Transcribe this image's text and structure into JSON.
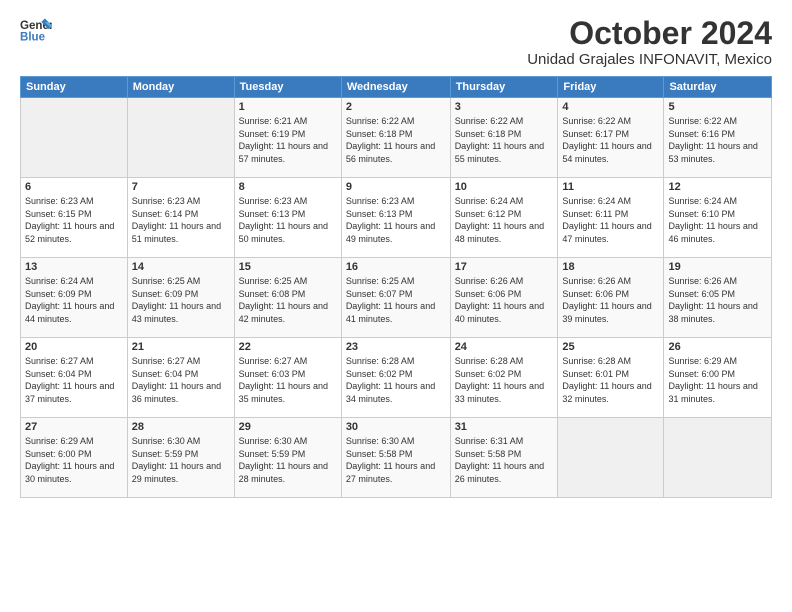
{
  "header": {
    "logo_general": "General",
    "logo_blue": "Blue",
    "title": "October 2024",
    "subtitle": "Unidad Grajales INFONAVIT, Mexico"
  },
  "weekdays": [
    "Sunday",
    "Monday",
    "Tuesday",
    "Wednesday",
    "Thursday",
    "Friday",
    "Saturday"
  ],
  "weeks": [
    [
      {
        "day": "",
        "info": ""
      },
      {
        "day": "",
        "info": ""
      },
      {
        "day": "1",
        "info": "Sunrise: 6:21 AM\nSunset: 6:19 PM\nDaylight: 11 hours and 57 minutes."
      },
      {
        "day": "2",
        "info": "Sunrise: 6:22 AM\nSunset: 6:18 PM\nDaylight: 11 hours and 56 minutes."
      },
      {
        "day": "3",
        "info": "Sunrise: 6:22 AM\nSunset: 6:18 PM\nDaylight: 11 hours and 55 minutes."
      },
      {
        "day": "4",
        "info": "Sunrise: 6:22 AM\nSunset: 6:17 PM\nDaylight: 11 hours and 54 minutes."
      },
      {
        "day": "5",
        "info": "Sunrise: 6:22 AM\nSunset: 6:16 PM\nDaylight: 11 hours and 53 minutes."
      }
    ],
    [
      {
        "day": "6",
        "info": "Sunrise: 6:23 AM\nSunset: 6:15 PM\nDaylight: 11 hours and 52 minutes."
      },
      {
        "day": "7",
        "info": "Sunrise: 6:23 AM\nSunset: 6:14 PM\nDaylight: 11 hours and 51 minutes."
      },
      {
        "day": "8",
        "info": "Sunrise: 6:23 AM\nSunset: 6:13 PM\nDaylight: 11 hours and 50 minutes."
      },
      {
        "day": "9",
        "info": "Sunrise: 6:23 AM\nSunset: 6:13 PM\nDaylight: 11 hours and 49 minutes."
      },
      {
        "day": "10",
        "info": "Sunrise: 6:24 AM\nSunset: 6:12 PM\nDaylight: 11 hours and 48 minutes."
      },
      {
        "day": "11",
        "info": "Sunrise: 6:24 AM\nSunset: 6:11 PM\nDaylight: 11 hours and 47 minutes."
      },
      {
        "day": "12",
        "info": "Sunrise: 6:24 AM\nSunset: 6:10 PM\nDaylight: 11 hours and 46 minutes."
      }
    ],
    [
      {
        "day": "13",
        "info": "Sunrise: 6:24 AM\nSunset: 6:09 PM\nDaylight: 11 hours and 44 minutes."
      },
      {
        "day": "14",
        "info": "Sunrise: 6:25 AM\nSunset: 6:09 PM\nDaylight: 11 hours and 43 minutes."
      },
      {
        "day": "15",
        "info": "Sunrise: 6:25 AM\nSunset: 6:08 PM\nDaylight: 11 hours and 42 minutes."
      },
      {
        "day": "16",
        "info": "Sunrise: 6:25 AM\nSunset: 6:07 PM\nDaylight: 11 hours and 41 minutes."
      },
      {
        "day": "17",
        "info": "Sunrise: 6:26 AM\nSunset: 6:06 PM\nDaylight: 11 hours and 40 minutes."
      },
      {
        "day": "18",
        "info": "Sunrise: 6:26 AM\nSunset: 6:06 PM\nDaylight: 11 hours and 39 minutes."
      },
      {
        "day": "19",
        "info": "Sunrise: 6:26 AM\nSunset: 6:05 PM\nDaylight: 11 hours and 38 minutes."
      }
    ],
    [
      {
        "day": "20",
        "info": "Sunrise: 6:27 AM\nSunset: 6:04 PM\nDaylight: 11 hours and 37 minutes."
      },
      {
        "day": "21",
        "info": "Sunrise: 6:27 AM\nSunset: 6:04 PM\nDaylight: 11 hours and 36 minutes."
      },
      {
        "day": "22",
        "info": "Sunrise: 6:27 AM\nSunset: 6:03 PM\nDaylight: 11 hours and 35 minutes."
      },
      {
        "day": "23",
        "info": "Sunrise: 6:28 AM\nSunset: 6:02 PM\nDaylight: 11 hours and 34 minutes."
      },
      {
        "day": "24",
        "info": "Sunrise: 6:28 AM\nSunset: 6:02 PM\nDaylight: 11 hours and 33 minutes."
      },
      {
        "day": "25",
        "info": "Sunrise: 6:28 AM\nSunset: 6:01 PM\nDaylight: 11 hours and 32 minutes."
      },
      {
        "day": "26",
        "info": "Sunrise: 6:29 AM\nSunset: 6:00 PM\nDaylight: 11 hours and 31 minutes."
      }
    ],
    [
      {
        "day": "27",
        "info": "Sunrise: 6:29 AM\nSunset: 6:00 PM\nDaylight: 11 hours and 30 minutes."
      },
      {
        "day": "28",
        "info": "Sunrise: 6:30 AM\nSunset: 5:59 PM\nDaylight: 11 hours and 29 minutes."
      },
      {
        "day": "29",
        "info": "Sunrise: 6:30 AM\nSunset: 5:59 PM\nDaylight: 11 hours and 28 minutes."
      },
      {
        "day": "30",
        "info": "Sunrise: 6:30 AM\nSunset: 5:58 PM\nDaylight: 11 hours and 27 minutes."
      },
      {
        "day": "31",
        "info": "Sunrise: 6:31 AM\nSunset: 5:58 PM\nDaylight: 11 hours and 26 minutes."
      },
      {
        "day": "",
        "info": ""
      },
      {
        "day": "",
        "info": ""
      }
    ]
  ]
}
